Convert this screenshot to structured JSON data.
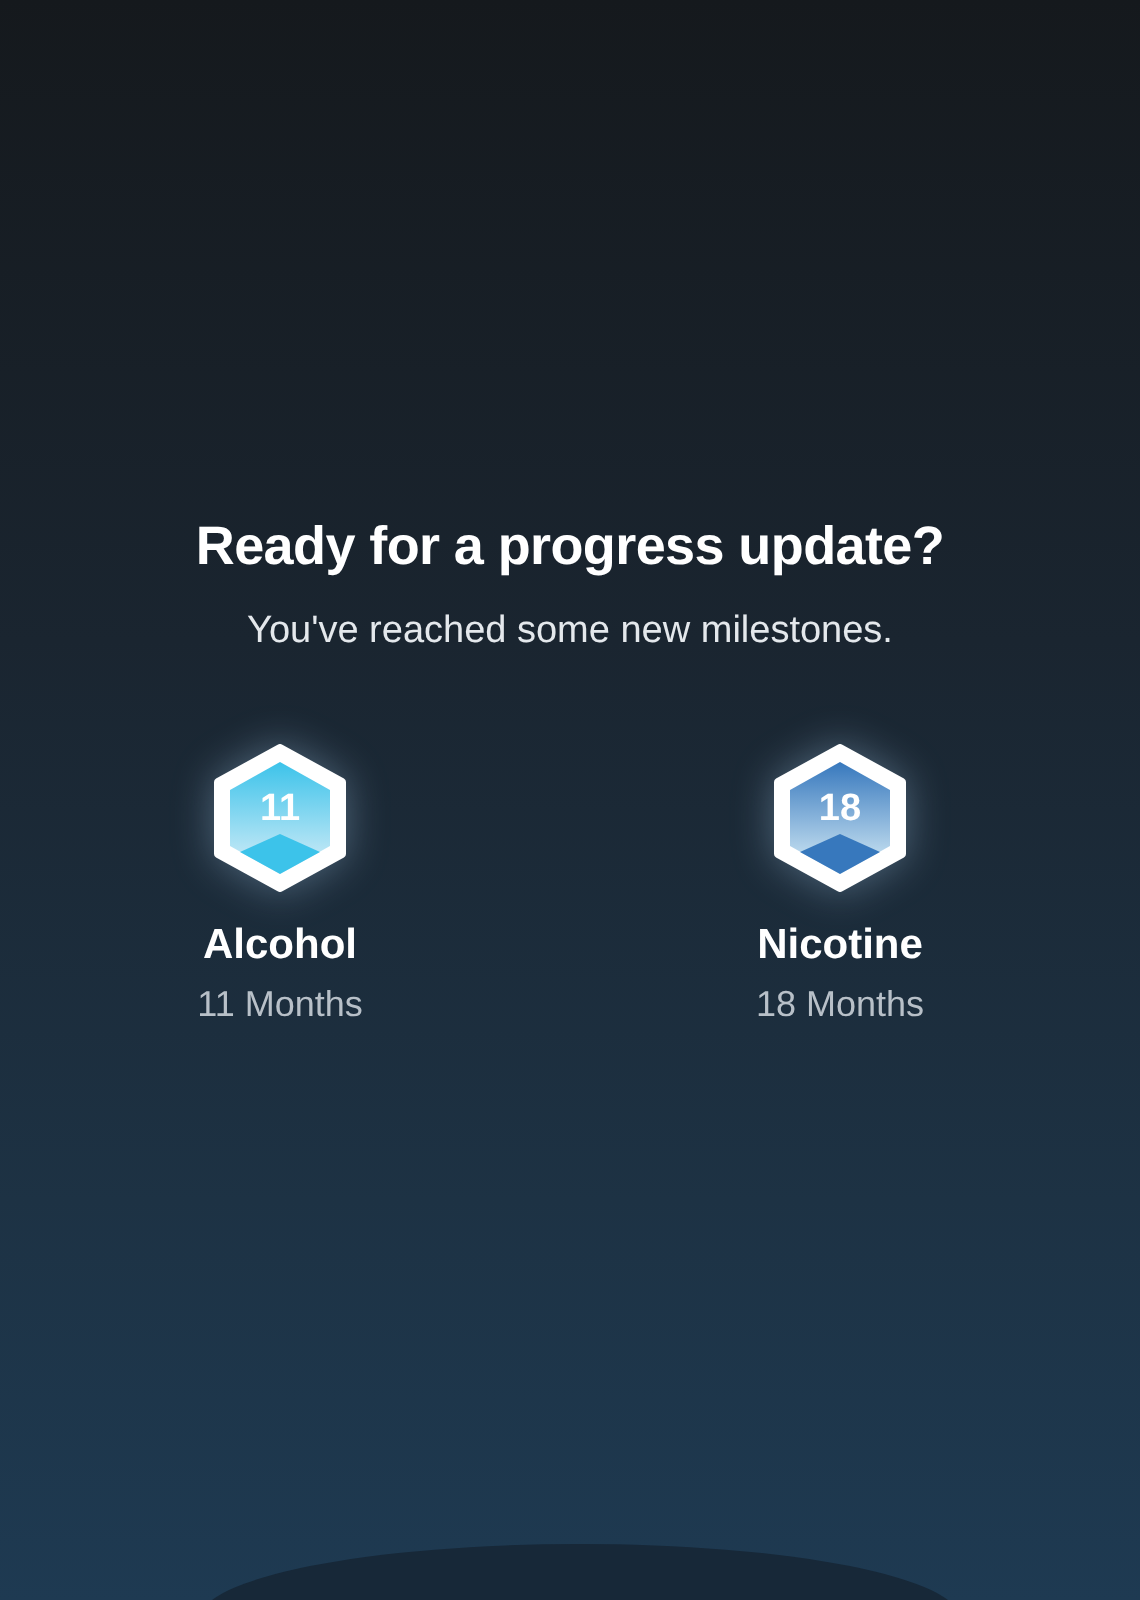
{
  "title": "Ready for a progress update?",
  "subtitle": "You've reached some new milestones.",
  "milestones": [
    {
      "badge": "11",
      "name": "Alcohol",
      "duration": "11 Months",
      "color": "#3cc3ea"
    },
    {
      "badge": "18",
      "name": "Nicotine",
      "duration": "18 Months",
      "color": "#3778bd"
    }
  ]
}
